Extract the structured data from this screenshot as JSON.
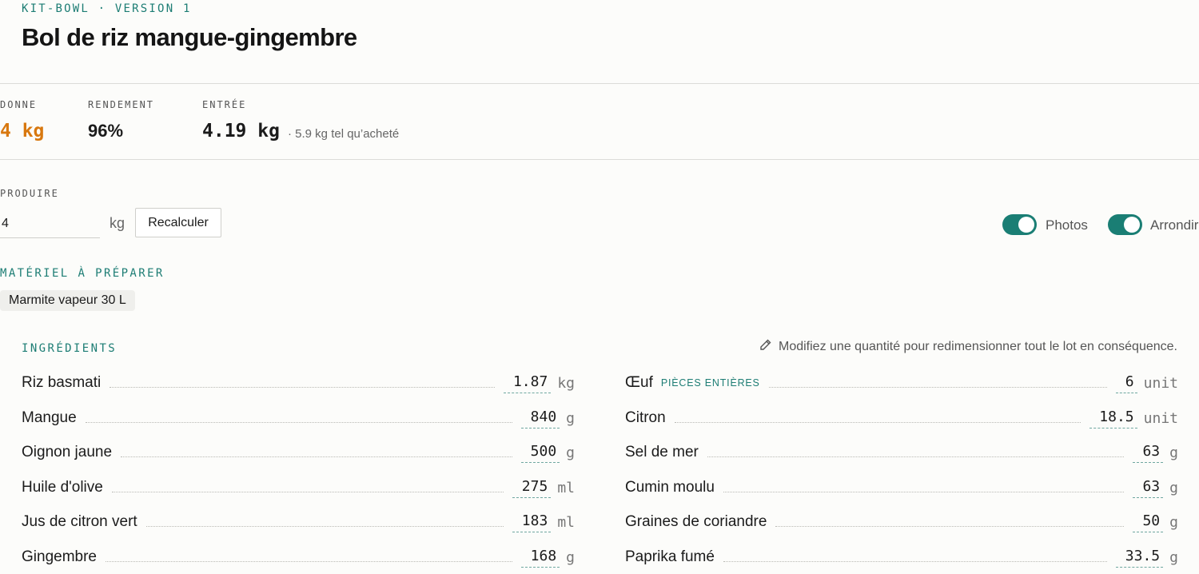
{
  "header": {
    "kicker": "KIT-BOWL · VERSION 1",
    "title": "Bol de riz mangue-gingembre"
  },
  "stats": {
    "donne": {
      "label": "DONNE",
      "value": "4 kg"
    },
    "rendement": {
      "label": "RENDEMENT",
      "value": "96%"
    },
    "entree": {
      "label": "ENTRÉE",
      "value": "4.19 kg",
      "note": "· 5.9 kg tel qu’acheté"
    }
  },
  "produce": {
    "label": "PRODUIRE",
    "value": "4",
    "unit": "kg",
    "button": "Recalculer"
  },
  "toggles": {
    "photos": {
      "label": "Photos",
      "on": true
    },
    "arrondir": {
      "label": "Arrondir",
      "on": true
    }
  },
  "equipment": {
    "heading": "MATÉRIEL À PRÉPARER",
    "items": [
      "Marmite vapeur 30 L"
    ]
  },
  "ingredients": {
    "heading": "INGRÉDIENTS",
    "hint": "Modifiez une quantité pour redimensionner tout le lot en conséquence.",
    "left": [
      {
        "name": "Riz basmati",
        "qty": "1.87",
        "unit": "kg"
      },
      {
        "name": "Mangue",
        "qty": "840",
        "unit": "g"
      },
      {
        "name": "Oignon jaune",
        "qty": "500",
        "unit": "g"
      },
      {
        "name": "Huile d'olive",
        "qty": "275",
        "unit": "ml"
      },
      {
        "name": "Jus de citron vert",
        "qty": "183",
        "unit": "ml"
      },
      {
        "name": "Gingembre",
        "qty": "168",
        "unit": "g"
      }
    ],
    "right": [
      {
        "name": "Œuf",
        "tag": "PIÈCES ENTIÈRES",
        "qty": "6",
        "unit": "unit"
      },
      {
        "name": "Citron",
        "qty": "18.5",
        "unit": "unit"
      },
      {
        "name": "Sel de mer",
        "qty": "63",
        "unit": "g"
      },
      {
        "name": "Cumin moulu",
        "qty": "63",
        "unit": "g"
      },
      {
        "name": "Graines de coriandre",
        "qty": "50",
        "unit": "g"
      },
      {
        "name": "Paprika fumé",
        "qty": "33.5",
        "unit": "g"
      }
    ]
  },
  "colors": {
    "accent": "#1a7e74",
    "highlight": "#d8780f"
  }
}
